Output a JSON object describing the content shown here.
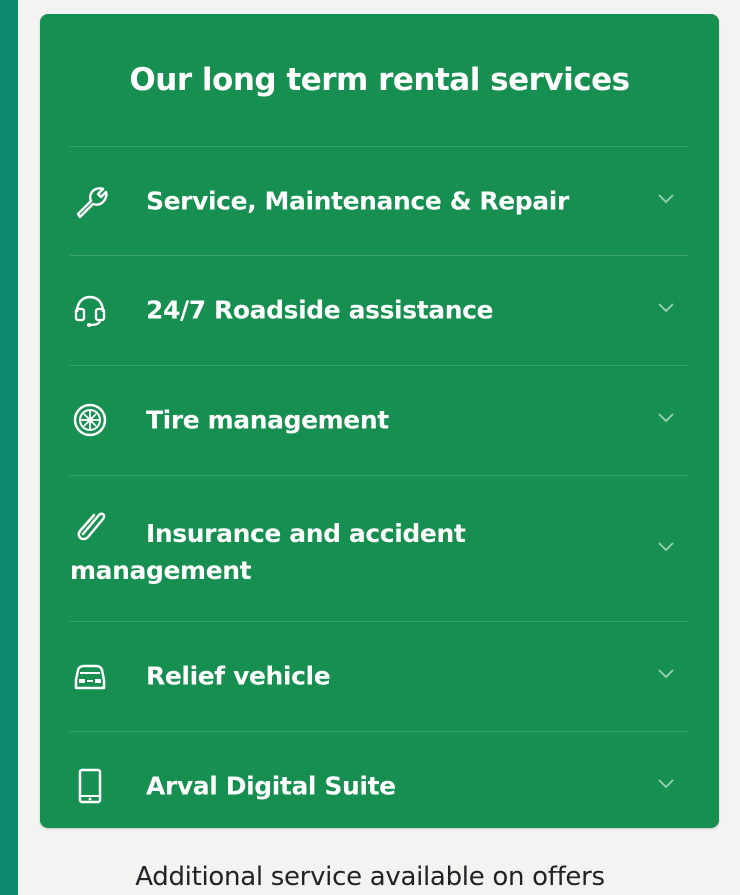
{
  "panel": {
    "title": "Our long term rental services",
    "accent_color": "#168f51",
    "background_color": "#0b8a6e",
    "items": [
      {
        "label": "Service, Maintenance & Repair",
        "icon": "wrench-icon"
      },
      {
        "label": "24/7 Roadside assistance",
        "icon": "headset-icon"
      },
      {
        "label": "Tire management",
        "icon": "tire-icon"
      },
      {
        "label": "Insurance and accident management",
        "icon": "paperclip-icon"
      },
      {
        "label": "Relief vehicle",
        "icon": "car-icon"
      },
      {
        "label": "Arval Digital Suite",
        "icon": "smartphone-icon"
      }
    ]
  },
  "footer": {
    "text": "Additional service available on offers"
  }
}
